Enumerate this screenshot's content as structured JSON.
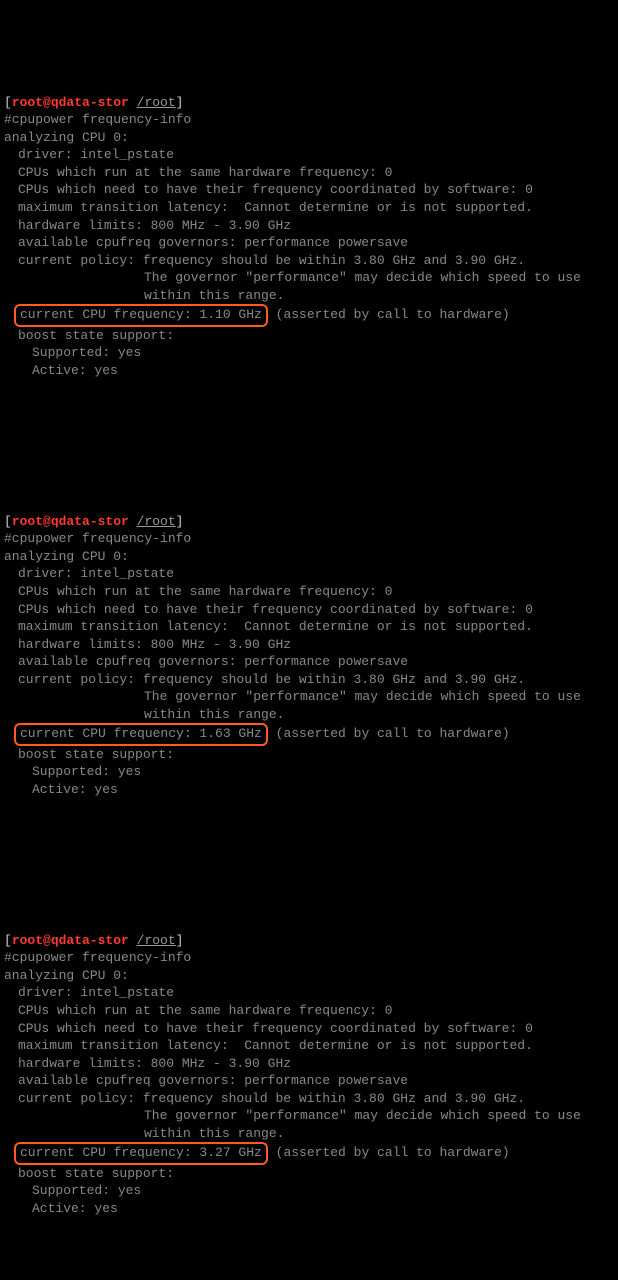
{
  "blocks": [
    {
      "prompt_user": "root@qdata-stor",
      "prompt_path": "/root",
      "command": "#cpupower frequency-info",
      "analyzing": "analyzing CPU 0:",
      "driver": "driver: intel_pstate",
      "cpus_same": "CPUs which run at the same hardware frequency: 0",
      "cpus_coord": "CPUs which need to have their frequency coordinated by software: 0",
      "max_trans": "maximum transition latency:  Cannot determine or is not supported.",
      "hw_limits": "hardware limits: 800 MHz - 3.90 GHz",
      "governors": "available cpufreq governors: performance powersave",
      "policy1": "current policy: frequency should be within 3.80 GHz and 3.90 GHz.",
      "policy2": "The governor \"performance\" may decide which speed to use",
      "policy3": "within this range.",
      "freq_highlight": "current CPU frequency: 1.10 GHz",
      "freq_tail": " (asserted by call to hardware)",
      "boost_state": "boost state support:",
      "supported": "Supported: yes",
      "active": "Active: yes"
    },
    {
      "prompt_user": "root@qdata-stor",
      "prompt_path": "/root",
      "command": "#cpupower frequency-info",
      "analyzing": "analyzing CPU 0:",
      "driver": "driver: intel_pstate",
      "cpus_same": "CPUs which run at the same hardware frequency: 0",
      "cpus_coord": "CPUs which need to have their frequency coordinated by software: 0",
      "max_trans": "maximum transition latency:  Cannot determine or is not supported.",
      "hw_limits": "hardware limits: 800 MHz - 3.90 GHz",
      "governors": "available cpufreq governors: performance powersave",
      "policy1": "current policy: frequency should be within 3.80 GHz and 3.90 GHz.",
      "policy2": "The governor \"performance\" may decide which speed to use",
      "policy3": "within this range.",
      "freq_highlight": "current CPU frequency: 1.63 GHz",
      "freq_tail": " (asserted by call to hardware)",
      "boost_state": "boost state support:",
      "supported": "Supported: yes",
      "active": "Active: yes"
    },
    {
      "prompt_user": "root@qdata-stor",
      "prompt_path": "/root",
      "command": "#cpupower frequency-info",
      "analyzing": "analyzing CPU 0:",
      "driver": "driver: intel_pstate",
      "cpus_same": "CPUs which run at the same hardware frequency: 0",
      "cpus_coord": "CPUs which need to have their frequency coordinated by software: 0",
      "max_trans": "maximum transition latency:  Cannot determine or is not supported.",
      "hw_limits": "hardware limits: 800 MHz - 3.90 GHz",
      "governors": "available cpufreq governors: performance powersave",
      "policy1": "current policy: frequency should be within 3.80 GHz and 3.90 GHz.",
      "policy2": "The governor \"performance\" may decide which speed to use",
      "policy3": "within this range.",
      "freq_highlight": "current CPU frequency: 3.27 GHz",
      "freq_tail": " (asserted by call to hardware)",
      "boost_state": "boost state support:",
      "supported": "Supported: yes",
      "active": "Active: yes"
    }
  ]
}
